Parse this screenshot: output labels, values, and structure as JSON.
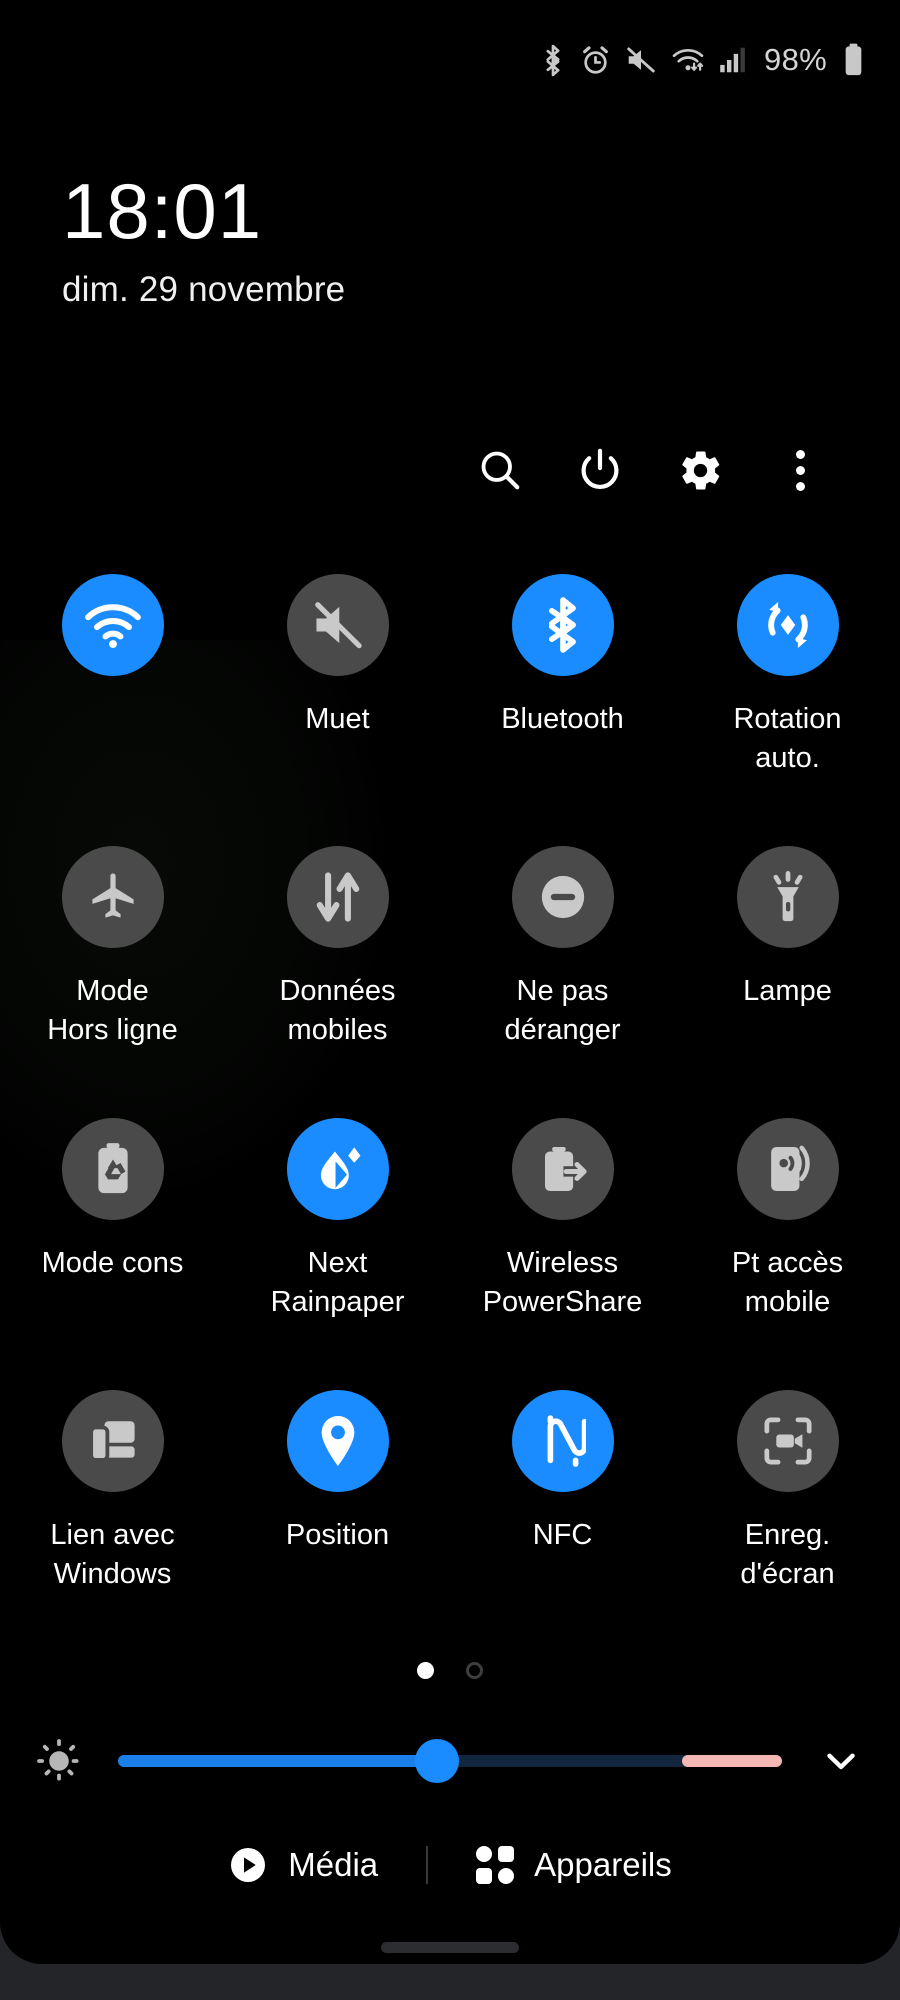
{
  "status_bar": {
    "icons": [
      "bluetooth-icon",
      "alarm-icon",
      "mute-icon",
      "wifi-data-icon",
      "signal-icon"
    ],
    "battery_percent": "98%",
    "battery_icon": "battery-full-icon"
  },
  "clock": {
    "time": "18:01",
    "date": "dim. 29 novembre"
  },
  "header_actions": [
    {
      "name": "search-button",
      "icon": "search-icon"
    },
    {
      "name": "power-button",
      "icon": "power-icon"
    },
    {
      "name": "settings-button",
      "icon": "gear-icon"
    },
    {
      "name": "more-options-button",
      "icon": "overflow-menu-icon"
    }
  ],
  "tiles": [
    {
      "label": "",
      "icon": "wifi-icon",
      "state": "on"
    },
    {
      "label": "Muet",
      "icon": "mute-icon",
      "state": "off"
    },
    {
      "label": "Bluetooth",
      "icon": "bluetooth-icon",
      "state": "on"
    },
    {
      "label": "Rotation\nauto.",
      "icon": "auto-rotate-icon",
      "state": "on"
    },
    {
      "label": "Mode\nHors ligne",
      "icon": "airplane-icon",
      "state": "off"
    },
    {
      "label": "Données\nmobiles",
      "icon": "mobile-data-icon",
      "state": "off"
    },
    {
      "label": "Ne pas\ndéranger",
      "icon": "do-not-disturb-icon",
      "state": "off"
    },
    {
      "label": "Lampe",
      "icon": "flashlight-icon",
      "state": "off"
    },
    {
      "label": "Mode cons",
      "icon": "power-saving-icon",
      "state": "off"
    },
    {
      "label": "Next\nRainpaper",
      "icon": "rainpaper-icon",
      "state": "on"
    },
    {
      "label": "Wireless\nPowerShare",
      "icon": "power-share-icon",
      "state": "off"
    },
    {
      "label": "Pt accès\nmobile",
      "icon": "hotspot-icon",
      "state": "off"
    },
    {
      "label": "Lien avec\nWindows",
      "icon": "link-to-windows-icon",
      "state": "off"
    },
    {
      "label": "Position",
      "icon": "location-pin-icon",
      "state": "on"
    },
    {
      "label": "NFC",
      "icon": "nfc-icon",
      "state": "on"
    },
    {
      "label": "Enreg.\nd'écran",
      "icon": "screen-record-icon",
      "state": "off"
    }
  ],
  "pager": {
    "total_pages": 2,
    "current_page": 1
  },
  "brightness": {
    "icon": "brightness-icon",
    "value_percent": 48,
    "warm_segment_percent": 15,
    "expand_icon": "chevron-down-icon"
  },
  "bottom_bar": {
    "media_label": "Média",
    "media_icon": "play-circle-icon",
    "devices_label": "Appareils",
    "devices_icon": "devices-grid-icon"
  },
  "colors": {
    "accent_blue": "#1a8cff",
    "tile_off": "#4a4a4a",
    "panel_bg": "#000000",
    "system_bg": "#232529",
    "warm_filter": "#f3b8b3"
  }
}
